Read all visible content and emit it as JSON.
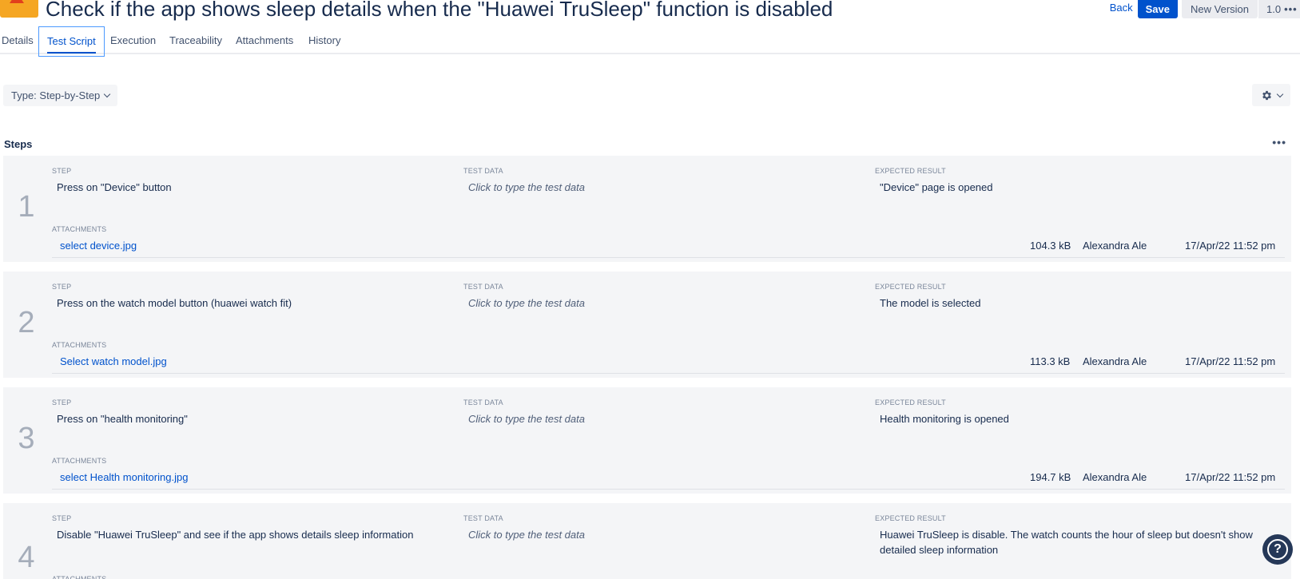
{
  "header": {
    "title": "Check if the app shows sleep details when the \"Huawei TruSleep\" function is disabled",
    "back_label": "Back",
    "save_label": "Save",
    "new_version_label": "New Version",
    "version": "1.0",
    "version_more": "•••"
  },
  "tabs": [
    {
      "label": "Details",
      "active": false
    },
    {
      "label": "Test Script",
      "active": true
    },
    {
      "label": "Execution",
      "active": false
    },
    {
      "label": "Traceability",
      "active": false
    },
    {
      "label": "Attachments",
      "active": false
    },
    {
      "label": "History",
      "active": false
    }
  ],
  "toolbar": {
    "type_label": "Type: Step-by-Step",
    "settings_icon": "gear-icon"
  },
  "steps_section": {
    "title": "Steps",
    "more": "•••"
  },
  "labels": {
    "step": "STEP",
    "test_data": "TEST DATA",
    "expected_result": "EXPECTED RESULT",
    "attachments": "ATTACHMENTS"
  },
  "steps": [
    {
      "number": "1",
      "step": "Press on \"Device\" button",
      "test_data": "Click to type the test data",
      "expected": "\"Device\" page is opened",
      "attachment": {
        "name": "select device.jpg",
        "size": "104.3 kB",
        "user": "Alexandra Ale",
        "date": "17/Apr/22 11:52 pm"
      }
    },
    {
      "number": "2",
      "step": "Press on the watch model  button (huawei watch fit)",
      "test_data": "Click to type the test data",
      "expected": "The model is selected",
      "attachment": {
        "name": "Select watch model.jpg",
        "size": "113.3 kB",
        "user": "Alexandra Ale",
        "date": "17/Apr/22 11:52 pm"
      }
    },
    {
      "number": "3",
      "step": "Press on \"health monitoring\"",
      "test_data": "Click to type the test data",
      "expected": "Health monitoring is opened",
      "attachment": {
        "name": "select Health monitoring.jpg",
        "size": "194.7 kB",
        "user": "Alexandra Ale",
        "date": "17/Apr/22 11:52 pm"
      }
    },
    {
      "number": "4",
      "step": "Disable \"Huawei TruSleep\" and see if the app shows details sleep information",
      "test_data": "Click to type the test data",
      "expected": "Huawei TruSleep is disable. The watch counts the hour of sleep but doesn't show detailed sleep information"
    }
  ],
  "help": {
    "label": "?"
  },
  "colors": {
    "accent": "#0052cc",
    "card_bg": "#f4f5f7",
    "logo": "#f5a623"
  }
}
